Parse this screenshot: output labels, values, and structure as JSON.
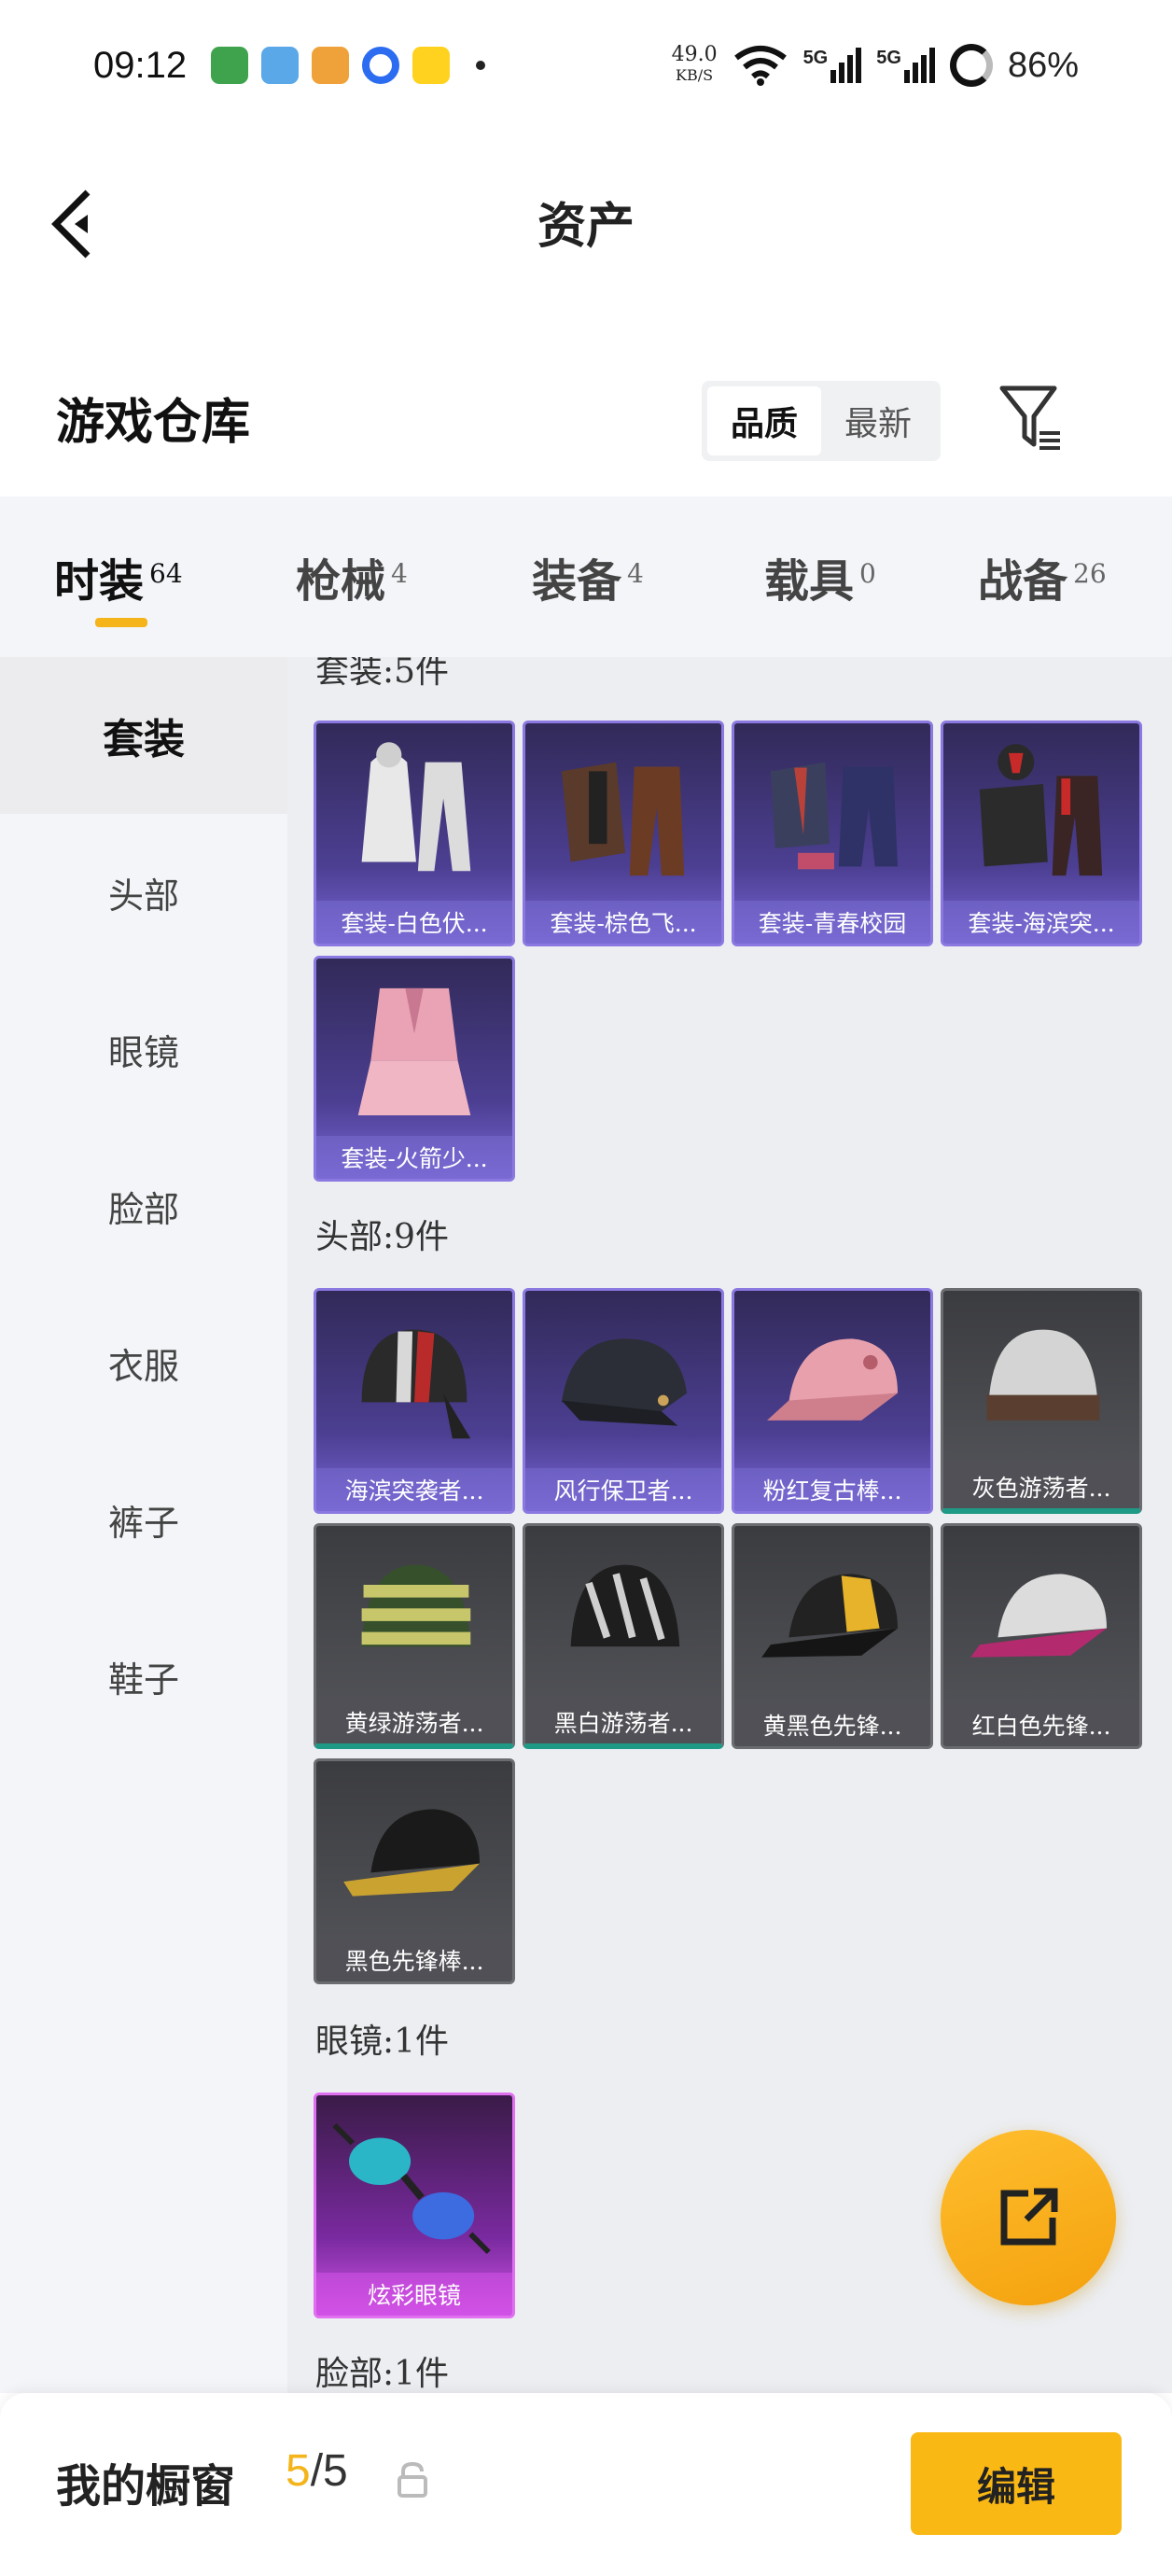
{
  "status_bar": {
    "time": "09:12",
    "net_speed_value": "49.0",
    "net_speed_unit": "KB/S",
    "signal1": "5G",
    "signal2": "5G",
    "battery": "86%"
  },
  "header": {
    "title": "资产"
  },
  "warehouse": {
    "title": "游戏仓库",
    "sort_options": [
      "品质",
      "最新"
    ],
    "active_sort": "品质"
  },
  "tabs": [
    {
      "label": "时装",
      "count": "64"
    },
    {
      "label": "枪械",
      "count": "4"
    },
    {
      "label": "装备",
      "count": "4"
    },
    {
      "label": "载具",
      "count": "0"
    },
    {
      "label": "战备",
      "count": "26"
    }
  ],
  "sidebar": {
    "items": [
      "套装",
      "头部",
      "眼镜",
      "脸部",
      "衣服",
      "裤子",
      "鞋子"
    ]
  },
  "sections": {
    "suits": {
      "title": "套装:5件",
      "items": [
        "套装-白色伏...",
        "套装-棕色飞...",
        "套装-青春校园",
        "套装-海滨突...",
        "套装-火箭少..."
      ]
    },
    "head": {
      "title": "头部:9件",
      "items": [
        "海滨突袭者...",
        "风行保卫者...",
        "粉红复古棒...",
        "灰色游荡者...",
        "黄绿游荡者...",
        "黑白游荡者...",
        "黄黑色先锋...",
        "红白色先锋...",
        "黑色先锋棒..."
      ]
    },
    "glasses": {
      "title": "眼镜:1件",
      "items": [
        "炫彩眼镜"
      ]
    },
    "face": {
      "title": "脸部:1件"
    }
  },
  "bottom_bar": {
    "showcase_label": "我的橱窗",
    "showcase_current": "5",
    "showcase_sep_total": "/5",
    "edit_label": "编辑"
  },
  "colors": {
    "accent": "#f4b41a",
    "purple_rarity": "#8b78e0",
    "gray_rarity": "#6b6c70",
    "magenta_rarity": "#e070f0"
  }
}
